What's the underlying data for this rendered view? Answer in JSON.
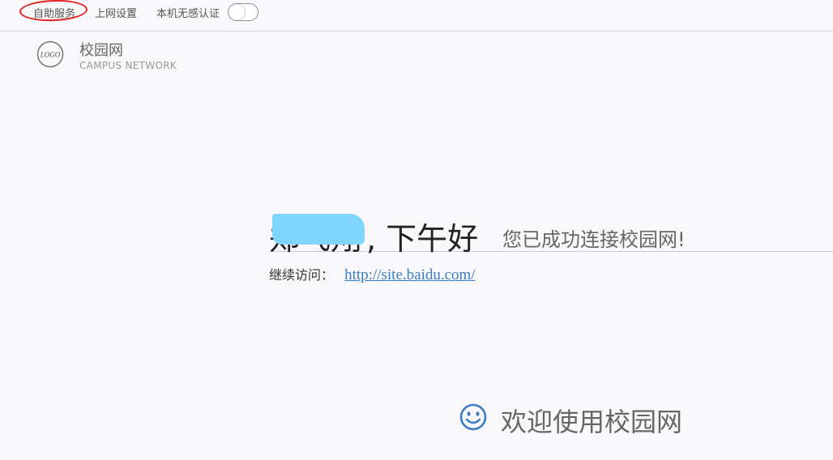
{
  "topbar": {
    "self_service": "自助服务",
    "net_settings": "上网设置",
    "auth_label": "本机无感认证",
    "auth_toggle_on": false
  },
  "brand": {
    "logo_text": "LOGO",
    "title": "校园网",
    "subtitle": "CAMPUS NETWORK"
  },
  "main": {
    "user_name": "郑飞翔",
    "greeting": ", 下午好",
    "success_message": "您已成功连接校园网!",
    "continue_label": "继续访问：",
    "continue_url": "http://site.baidu.com/"
  },
  "footer": {
    "welcome_text": "欢迎使用校园网",
    "icon": "smile-icon"
  },
  "colors": {
    "accent": "#3b7dc4",
    "mask": "#7fd5fb",
    "highlight_circle": "#e02424"
  }
}
